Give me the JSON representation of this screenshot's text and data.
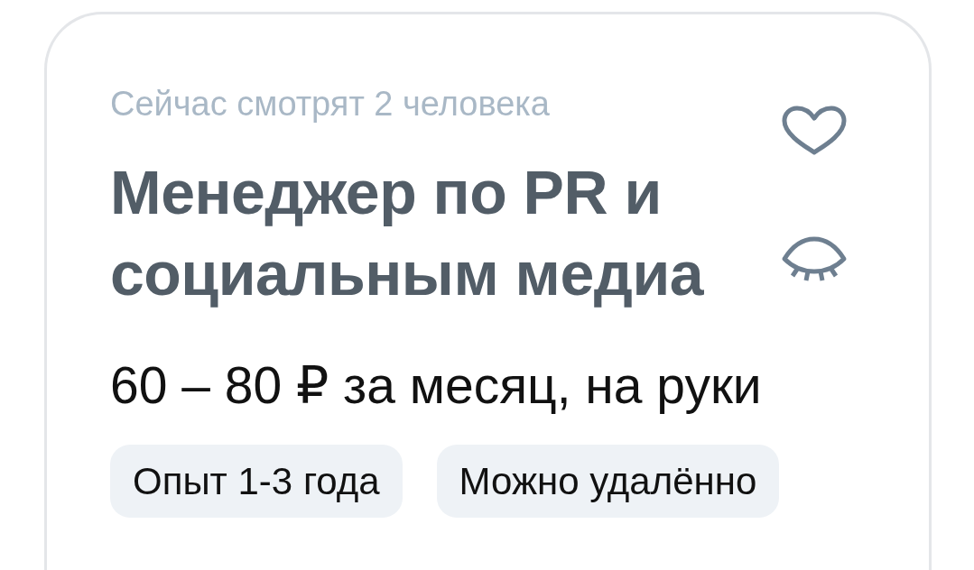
{
  "card": {
    "viewers_note": "Сейчас смотрят 2 человека",
    "title": "Менеджер по PR и социальным медиа",
    "salary": "60 – 80 ₽ за месяц, на руки",
    "tags": [
      "Опыт 1-3 года",
      "Можно удалённо"
    ]
  }
}
